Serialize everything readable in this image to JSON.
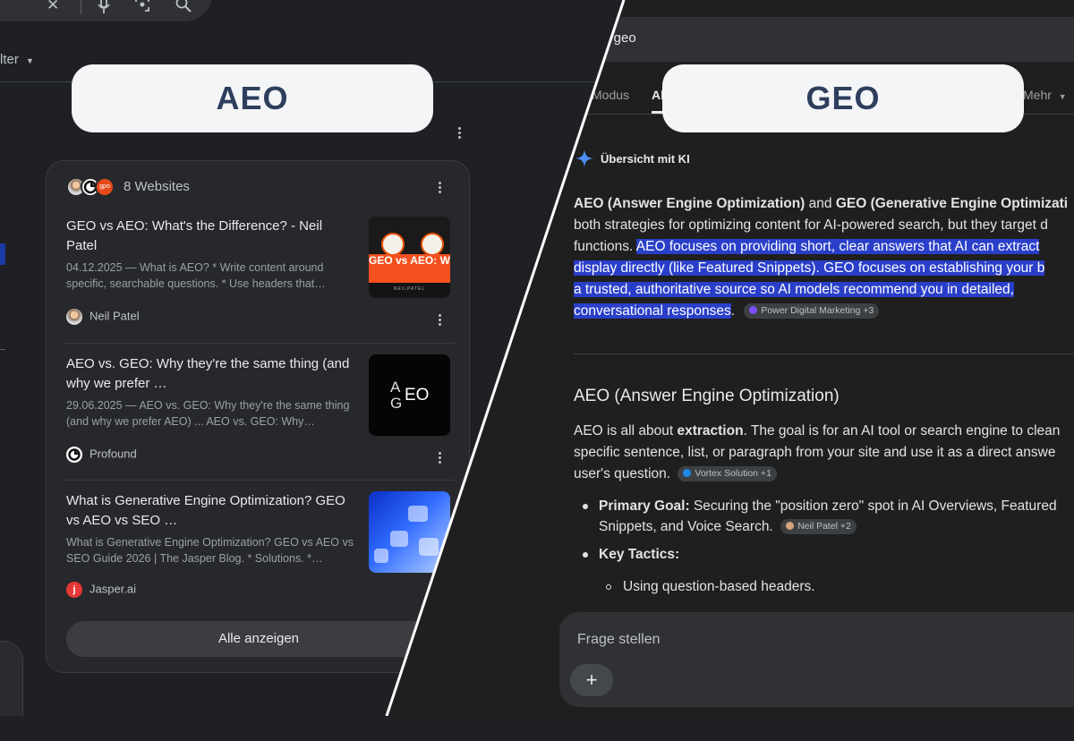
{
  "left": {
    "label": "AEO",
    "filter_label": "lter",
    "card": {
      "header": "8 Websites",
      "results": [
        {
          "title": "GEO vs AEO: What's the Difference? - Neil Patel",
          "snippet": "04.12.2025 — What is AEO? * Write content around specific, searchable questions. * Use headers that…",
          "source": "Neil Patel",
          "thumb_text": "GEO vs AEO: What's the Difference",
          "thumb_foot": "NEILPATEL"
        },
        {
          "title": "AEO vs. GEO: Why they're the same thing (and why we prefer …",
          "snippet": "29.06.2025 — AEO vs. GEO: Why they're the same thing (and why we prefer AEO) ... AEO vs. GEO: Why…",
          "source": "Profound",
          "thumb_text_a": "A",
          "thumb_text_g": "G",
          "thumb_text_eo": "EO"
        },
        {
          "title": "What is Generative Engine Optimization? GEO vs AEO vs SEO …",
          "snippet": "What is Generative Engine Optimization? GEO vs AEO vs SEO Guide 2026 | The Jasper Blog. * Solutions. *…",
          "source": "Jasper.ai"
        }
      ],
      "show_all": "Alle anzeigen"
    }
  },
  "right": {
    "label": "GEO",
    "search_value": "s geo",
    "tabs": [
      "Modus",
      "Al",
      "Mehr"
    ],
    "ai_title": "Übersicht mit KI",
    "para": {
      "b1": "AEO (Answer Engine Optimization)",
      "t1": " and ",
      "b2": "GEO (Generative Engine Optimizati",
      "l2": "both strategies for optimizing content for AI-powered search, but they target d",
      "l3a": "functions. ",
      "l3b": "AEO focuses on providing short, clear answers that AI can extract",
      "l4": "display directly (like Featured Snippets). GEO focuses on establishing your b",
      "l5": "a trusted, authoritative source so AI models recommend you in detailed,",
      "l6": "conversational responses",
      "l6end": ".",
      "chip": "Power Digital Marketing +3"
    },
    "section": {
      "heading": "AEO (Answer Engine Optimization)",
      "p1a": "AEO is all about ",
      "p1b": "extraction",
      "p1c": ". The goal is for an AI tool or search engine to clean",
      "p2": "specific sentence, list, or paragraph from your site and use it as a direct answe",
      "p3": "user's question.",
      "chip1": "Vortex Solution +1",
      "bullet1_label": "Primary Goal:",
      "bullet1_text": " Securing the \"position zero\" spot in AI Overviews, Featured",
      "bullet1_text2": "Snippets, and Voice Search.",
      "chip2": "Neil Patel +2",
      "bullet2_label": "Key Tactics:",
      "sub1": "Using question-based headers."
    },
    "input_placeholder": "Frage stellen",
    "plus_label": "+"
  },
  "colors": {
    "highlight": "#2a3fc9",
    "label_text": "#2e3e5c",
    "label_bg": "#f4f5f7",
    "accent_orange": "#f4511e"
  }
}
